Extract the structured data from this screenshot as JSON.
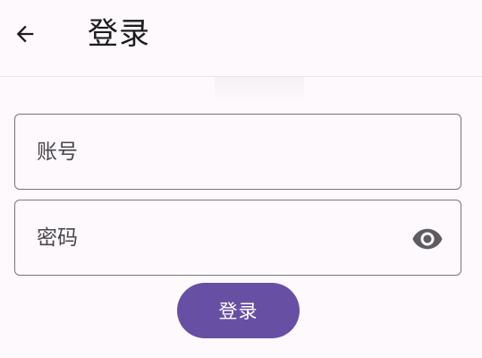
{
  "app_bar": {
    "back_icon": "arrow-left-icon",
    "title": "登录"
  },
  "form": {
    "account": {
      "placeholder": "账号",
      "value": ""
    },
    "password": {
      "placeholder": "密码",
      "value": "",
      "visibility_icon": "eye-icon"
    },
    "submit_label": "登录"
  },
  "colors": {
    "background": "#fef9fc",
    "primary": "#6750a4",
    "outline": "#79747e",
    "on_surface": "#1d1b20",
    "icon": "#5f5b63"
  }
}
